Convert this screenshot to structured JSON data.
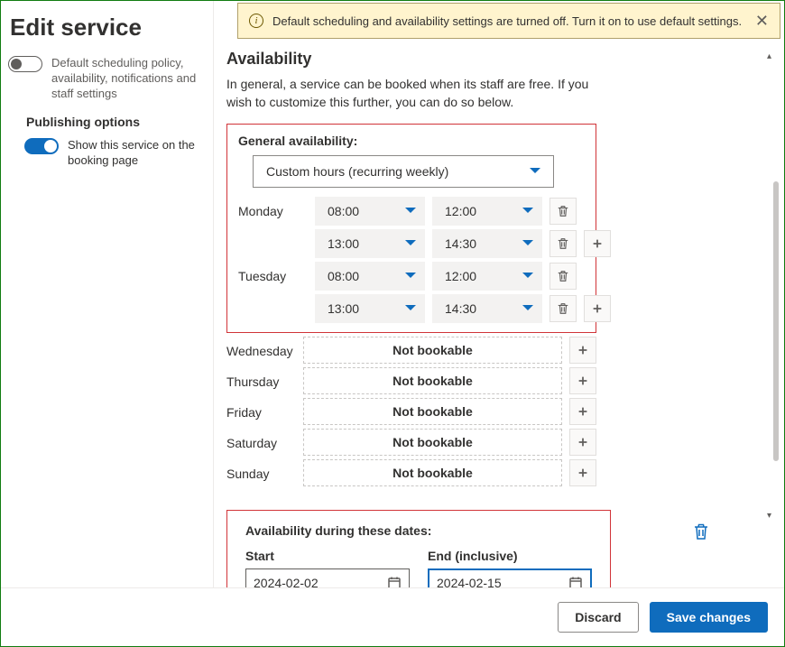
{
  "page_title": "Edit service",
  "sidebar": {
    "defaults_toggle_label": "Default scheduling policy, availability, notifications and staff settings",
    "publishing_heading": "Publishing options",
    "show_on_page_label": "Show this service on the booking page"
  },
  "notification": {
    "text": "Default scheduling and availability settings are turned off. Turn it on to use default settings."
  },
  "main": {
    "heading": "Availability",
    "intro": "In general, a service can be booked when its staff are free. If you wish to customize this further, you can do so below.",
    "general_heading": "General availability:",
    "availability_type": "Custom hours (recurring weekly)",
    "days": [
      {
        "name": "Monday",
        "slots": [
          {
            "start": "08:00",
            "end": "12:00",
            "show_plus": false
          },
          {
            "start": "13:00",
            "end": "14:30",
            "show_plus": true
          }
        ]
      },
      {
        "name": "Tuesday",
        "slots": [
          {
            "start": "08:00",
            "end": "12:00",
            "show_plus": false
          },
          {
            "start": "13:00",
            "end": "14:30",
            "show_plus": true
          }
        ]
      }
    ],
    "not_bookable_days": [
      "Wednesday",
      "Thursday",
      "Friday",
      "Saturday",
      "Sunday"
    ],
    "not_bookable_text": "Not bookable",
    "date_range": {
      "heading": "Availability during these dates:",
      "start_label": "Start",
      "end_label": "End (inclusive)",
      "start_value": "2024-02-02",
      "end_value": "2024-02-15"
    }
  },
  "footer": {
    "discard": "Discard",
    "save": "Save changes"
  }
}
